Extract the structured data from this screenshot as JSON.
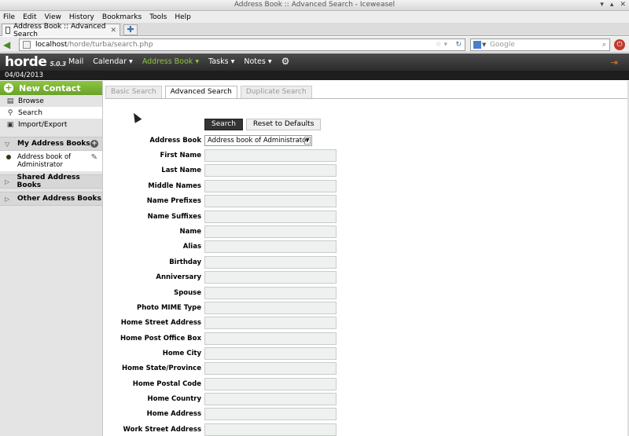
{
  "window": {
    "title": "Address Book :: Advanced Search - Iceweasel",
    "controls": [
      "▾",
      "▴",
      "✕"
    ]
  },
  "menubar": [
    "File",
    "Edit",
    "View",
    "History",
    "Bookmarks",
    "Tools",
    "Help"
  ],
  "browser_tab": {
    "label": "Address Book :: Advanced Search",
    "close": "✕",
    "new_tab": "✚"
  },
  "navbar": {
    "url_host": "localhost",
    "url_path": "/horde/turba/search.php",
    "search_placeholder": "Google"
  },
  "header": {
    "logo": "horde",
    "version": "5.0.3",
    "menu": [
      "Mail",
      "Calendar ▾",
      "Address Book ▾",
      "Tasks ▾",
      "Notes ▾"
    ],
    "active_menu": "Address Book ▾",
    "date": "04/04/2013"
  },
  "sidebar": {
    "new_contact": "New Contact",
    "items": [
      {
        "label": "Browse",
        "icon": "book-icon"
      },
      {
        "label": "Search",
        "icon": "search-icon"
      },
      {
        "label": "Import/Export",
        "icon": "import-export-icon"
      }
    ],
    "sections": {
      "my": "My Address Books",
      "shared": "Shared Address Books",
      "other": "Other Address Books"
    },
    "book_name_line1": "Address book of",
    "book_name_line2": "Administrator"
  },
  "search_tabs": [
    "Basic Search",
    "Advanced Search",
    "Duplicate Search"
  ],
  "active_search_tab": "Advanced Search",
  "buttons": {
    "search": "Search",
    "reset": "Reset to Defaults"
  },
  "address_book_select": {
    "label": "Address Book",
    "value": "Address book of Administrator"
  },
  "fields": [
    "First Name",
    "Last Name",
    "Middle Names",
    "Name Prefixes",
    "Name Suffixes",
    "Name",
    "Alias",
    "Birthday",
    "Anniversary",
    "Spouse",
    "Photo MIME Type",
    "Home Street Address",
    "Home Post Office Box",
    "Home City",
    "Home State/Province",
    "Home Postal Code",
    "Home Country",
    "Home Address",
    "Work Street Address"
  ]
}
